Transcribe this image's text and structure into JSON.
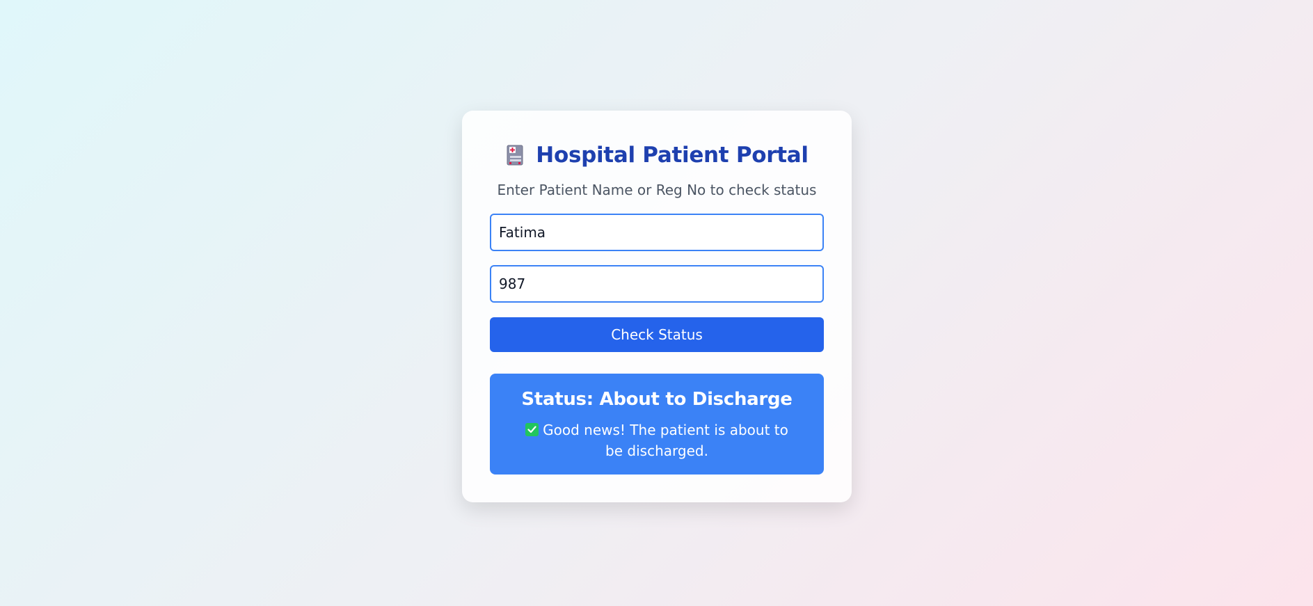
{
  "header": {
    "title": "Hospital Patient Portal",
    "icon": "hospital-icon",
    "subtitle": "Enter Patient Name or Reg No to check status"
  },
  "form": {
    "name_value": "Fatima",
    "reg_value": "987",
    "button_label": "Check Status"
  },
  "status": {
    "heading": "Status: About to Discharge",
    "icon": "check-icon",
    "message": "Good news! The patient is about to be discharged."
  },
  "colors": {
    "title": "#1e40af",
    "button": "#2563eb",
    "status_box": "#3b82f6",
    "check": "#22c55e"
  }
}
